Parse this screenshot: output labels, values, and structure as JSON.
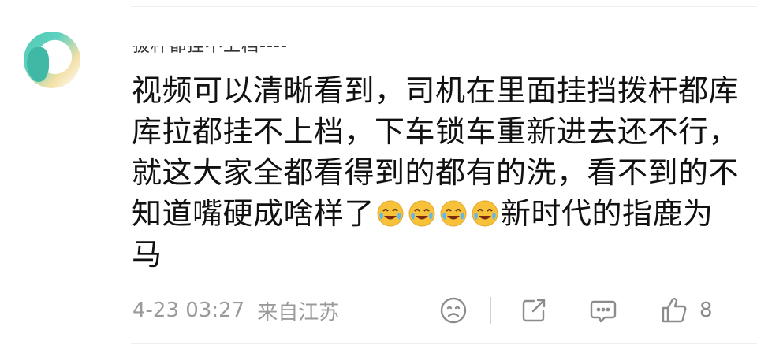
{
  "comment": {
    "username": "拔杆都挂不上档----",
    "text_part1": "视频可以清晰看到，司机在里面挂挡拨杆都库库拉都挂不上档，下车锁车重新进去还不行，就这大家全都看得到的都有的洗，看不到的不知道嘴硬成啥样了",
    "emojis": [
      "crying-laughing-emoji",
      "crying-laughing-emoji",
      "crying-laughing-emoji",
      "crying-laughing-emoji"
    ],
    "text_part2": "新时代的指鹿为马",
    "timestamp": "4-23 03:27",
    "location": "来自江苏",
    "like_count": "8"
  },
  "icons": {
    "react": "smiley-face-icon",
    "share": "share-icon",
    "reply": "comment-bubble-icon",
    "like": "thumbs-up-icon"
  },
  "colors": {
    "text": "#111111",
    "meta": "#9a9a9a",
    "icon": "#8c8c8c",
    "emoji_face": "#f7c23a"
  }
}
